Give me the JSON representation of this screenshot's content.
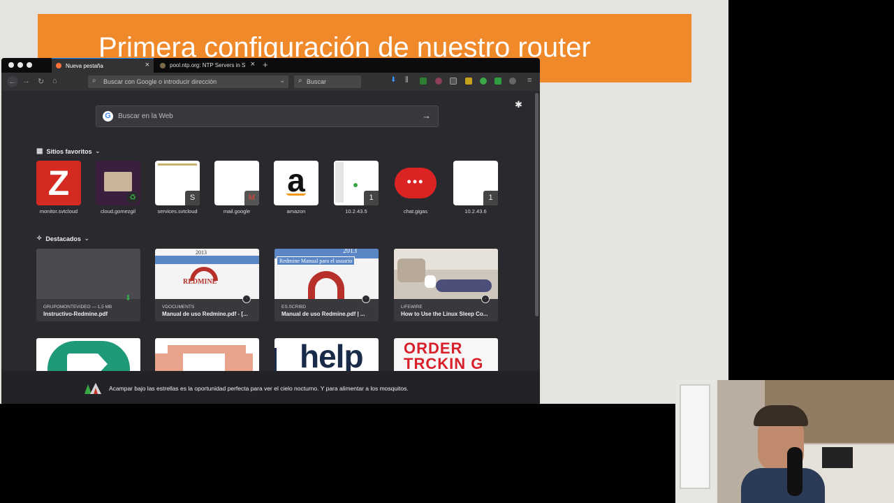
{
  "slide": {
    "title": "Primera configuración de nuestro router"
  },
  "tabs": [
    {
      "label": "Nueva pestaña",
      "active": true
    },
    {
      "label": "pool.ntp.org: NTP Servers in Sp",
      "active": false
    }
  ],
  "toolbar": {
    "url_placeholder": "Buscar con Google o introducir dirección",
    "search_placeholder": "Buscar"
  },
  "newtab": {
    "web_search_placeholder": "Buscar en la Web",
    "top_sites_heading": "Sitios favoritos",
    "highlights_heading": "Destacados",
    "top_sites": [
      {
        "label": "monitor.svtcloud",
        "badge": ""
      },
      {
        "label": "cloud.gomezgil",
        "badge": ""
      },
      {
        "label": "services.svtcloud",
        "badge": "S"
      },
      {
        "label": "mail.google",
        "badge": ""
      },
      {
        "label": "amazon",
        "badge": ""
      },
      {
        "label": "10.2.43.5",
        "badge": "1"
      },
      {
        "label": "chat.gigas",
        "badge": ""
      },
      {
        "label": "10.2.43.6",
        "badge": "1"
      }
    ],
    "highlights": [
      {
        "source": "GRUPOMONTEVIDEO — 1,5 MB",
        "title": "Instructivo-Redmine.pdf"
      },
      {
        "source": "VDOCUMENTS",
        "title": "Manual de uso Redmine.pdf - [..."
      },
      {
        "source": "ES.SCRIBD",
        "title": "Manual de uso Redmine.pdf | ..."
      },
      {
        "source": "LIFEWIRE",
        "title": "How to Use the Linux Sleep Co..."
      }
    ],
    "row3_texts": {
      "help": "help",
      "order": "ORDER",
      "tracking": "TRCKIN G"
    },
    "snippet": "Acampar bajo las estrellas es la oportunidad perfecta para ver el cielo nocturno. Y para alimentar a los mosquitos.",
    "redmine_banner_text": "Redmine Manual para el usuario",
    "year_text": "2013",
    "redmine_word": "REDMINE"
  },
  "icons": {
    "zotero_letter": "Z",
    "amazon_letter": "a"
  },
  "colors": {
    "slide_banner": "#f0892a",
    "browser_bg": "#2a2a2e",
    "accent_blue": "#0a84ff"
  }
}
